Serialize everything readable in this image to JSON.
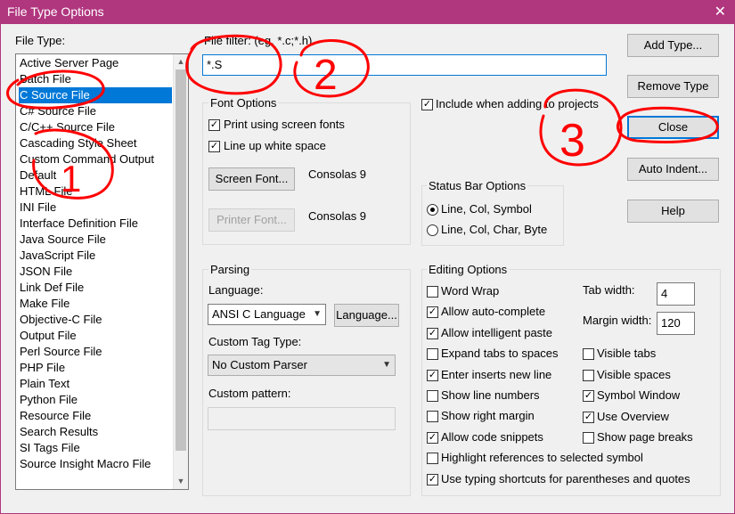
{
  "window": {
    "title": "File Type Options",
    "close_glyph": "✕"
  },
  "file_type": {
    "label": "File Type:",
    "items": [
      "Active Server Page",
      "Batch File",
      "C Source File",
      "C# Source File",
      "C/C++ Source File",
      "Cascading Style Sheet",
      "Custom Command Output",
      "Default",
      "HTML File",
      "INI File",
      "Interface Definition File",
      "Java Source File",
      "JavaScript File",
      "JSON File",
      "Link Def File",
      "Make File",
      "Objective-C File",
      "Output File",
      "Perl Source File",
      "PHP File",
      "Plain Text",
      "Python File",
      "Resource File",
      "Search Results",
      "SI Tags File",
      "Source Insight Macro File"
    ],
    "selected_index": 2,
    "scroll_up": "▲",
    "scroll_down": "▼"
  },
  "file_filter": {
    "label": "File filter: (eg. *.c;*.h)",
    "value": "*.S"
  },
  "include_when_adding": {
    "label": "Include when adding to projects",
    "checked": true
  },
  "font_options": {
    "title": "Font Options",
    "print_screen_fonts": {
      "label": "Print using screen fonts",
      "checked": true
    },
    "line_up_white_space": {
      "label": "Line up white space",
      "checked": true
    },
    "screen_font_button": "Screen Font...",
    "screen_font_value": "Consolas 9",
    "printer_font_button": "Printer Font...",
    "printer_font_value": "Consolas 9"
  },
  "status_bar": {
    "title": "Status Bar Options",
    "options": [
      "Line, Col, Symbol",
      "Line, Col, Char, Byte"
    ],
    "selected_index": 0
  },
  "parsing": {
    "title": "Parsing",
    "language_label": "Language:",
    "language_value": "ANSI C Language",
    "language_button": "Language...",
    "custom_tag_label": "Custom Tag Type:",
    "custom_tag_value": "No Custom Parser",
    "custom_pattern_label": "Custom pattern:",
    "custom_pattern_value": ""
  },
  "editing": {
    "title": "Editing Options",
    "left_options": [
      {
        "label": "Word Wrap",
        "checked": false
      },
      {
        "label": "Allow auto-complete",
        "checked": true
      },
      {
        "label": "Allow intelligent paste",
        "checked": true
      },
      {
        "label": "Expand tabs to spaces",
        "checked": false
      },
      {
        "label": "Enter inserts new line",
        "checked": true
      },
      {
        "label": "Show line numbers",
        "checked": false
      },
      {
        "label": "Show right margin",
        "checked": false
      },
      {
        "label": "Allow code snippets",
        "checked": true
      }
    ],
    "tab_width_label": "Tab width:",
    "tab_width_value": "4",
    "margin_width_label": "Margin width:",
    "margin_width_value": "120",
    "right_options": [
      {
        "label": "Visible tabs",
        "checked": false
      },
      {
        "label": "Visible spaces",
        "checked": false
      },
      {
        "label": "Symbol Window",
        "checked": true
      },
      {
        "label": "Use Overview",
        "checked": true
      },
      {
        "label": "Show page breaks",
        "checked": false
      }
    ],
    "bottom_options": [
      {
        "label": "Highlight references to selected symbol",
        "checked": false
      },
      {
        "label": "Use typing shortcuts for parentheses and quotes",
        "checked": true
      }
    ]
  },
  "buttons": {
    "add_type": "Add Type...",
    "remove_type": "Remove Type",
    "close": "Close",
    "auto_indent": "Auto Indent...",
    "help": "Help"
  },
  "annotations": {
    "one": "1",
    "two": "2",
    "three": "3",
    "color": "#ff0000"
  },
  "colors": {
    "titlebar": "#b0367e",
    "selection": "#0078d7",
    "focus": "#0078d7"
  }
}
